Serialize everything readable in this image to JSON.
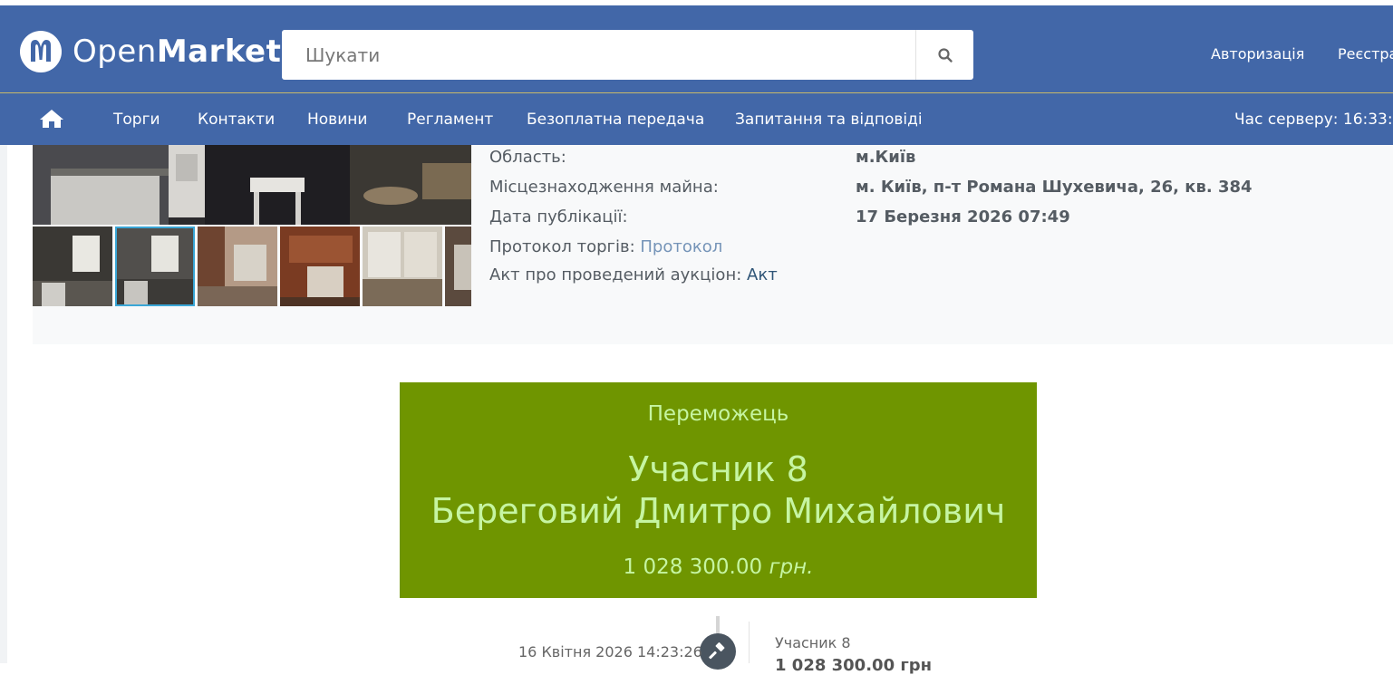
{
  "header": {
    "brand_prefix": "Open",
    "brand_suffix": "Market",
    "search_placeholder": "Шукати",
    "login": "Авторизація",
    "register": "Реєстра"
  },
  "nav": {
    "items": [
      "Торги",
      "Контакти",
      "Новини",
      "Регламент",
      "Безоплатна передача",
      "Запитання та відповіді"
    ],
    "server_time": "Час серверу: 16:33:"
  },
  "details": {
    "region_label": "Область:",
    "region_value": "м.Київ",
    "location_label": "Місцезнаходження майна:",
    "location_value": "м. Київ, п-т Романа Шухевича, 26, кв. 384",
    "published_label": "Дата публікації:",
    "published_value": "17 Березня 2026 07:49",
    "protocol_label": "Протокол торгів:",
    "protocol_link": "Протокол",
    "act_label": "Акт про проведений аукціон:",
    "act_link": "Акт"
  },
  "winner": {
    "label": "Переможець",
    "participant": "Учасник 8",
    "name": "Береговий Дмитро Михайлович",
    "amount": "1 028 300.00",
    "currency": "грн."
  },
  "timeline": {
    "date": "16 Квітня 2026 14:23:26",
    "participant": "Учасник 8",
    "amount": "1 028 300.00 грн"
  },
  "colors": {
    "header_blue": "#4267a8",
    "winner_green": "#6f9500",
    "winner_text": "#c6f5a2",
    "thumb_active_border": "#3aa6d6"
  }
}
